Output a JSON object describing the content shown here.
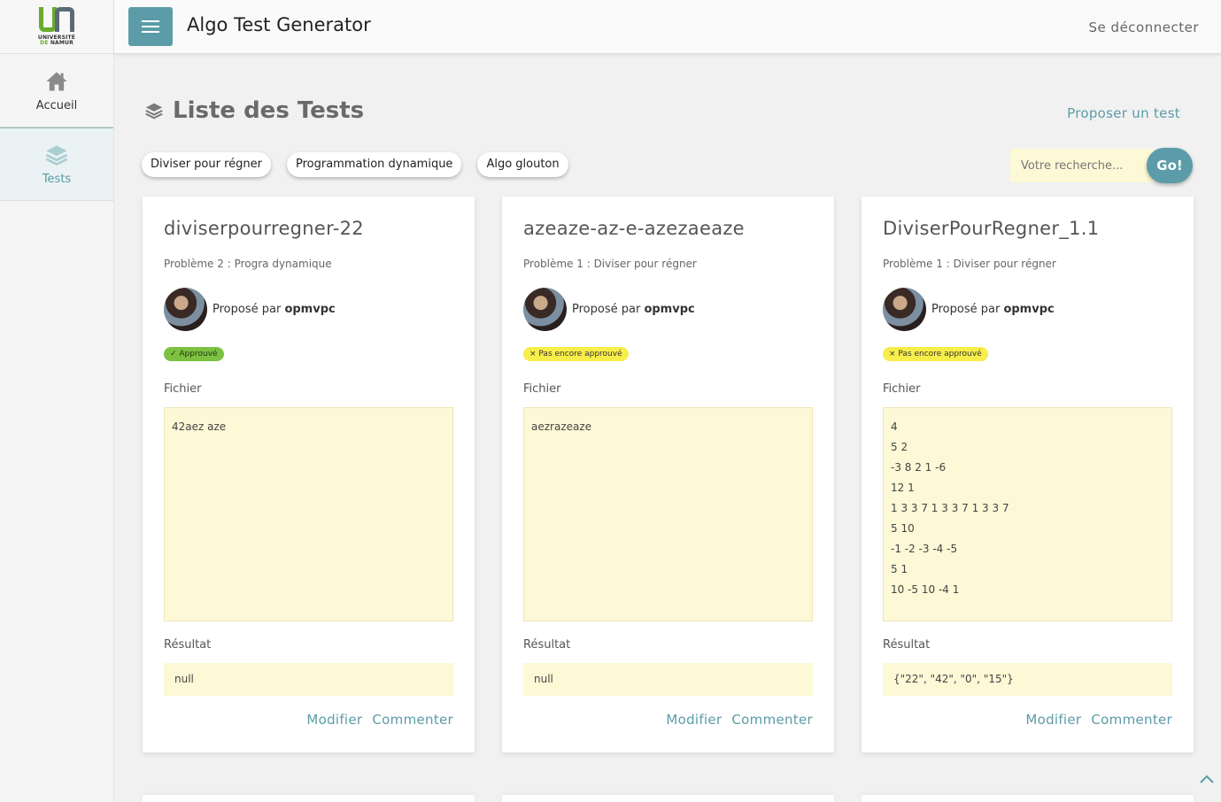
{
  "sidebar": {
    "logo_line1": "UNIVERSITÉ",
    "logo_de": "DE",
    "logo_line2": "NAMUR",
    "items": [
      {
        "label": "Accueil",
        "icon": "home-icon"
      },
      {
        "label": "Tests",
        "icon": "layers-icon"
      }
    ]
  },
  "header": {
    "title": "Algo Test Generator",
    "logout": "Se déconnecter"
  },
  "page": {
    "title": "Liste des Tests",
    "propose": "Proposer un test"
  },
  "filters": [
    "Diviser pour régner",
    "Programmation dynamique",
    "Algo glouton"
  ],
  "search": {
    "placeholder": "Votre recherche...",
    "button": "Go!"
  },
  "labels": {
    "proposed_by": "Proposé par",
    "file": "Fichier",
    "result": "Résultat",
    "edit": "Modifier",
    "comment": "Commenter"
  },
  "cards": [
    {
      "title": "diviserpourregner-22",
      "problem": "Problème 2 : Progra dynamique",
      "author": "opmvpc",
      "status": "✓ Approuvé",
      "status_kind": "approved",
      "file": "42aez aze",
      "result": "null"
    },
    {
      "title": "azeaze-az-e-azezaeaze",
      "problem": "Problème 1 : Diviser pour régner",
      "author": "opmvpc",
      "status": "× Pas encore approuvé",
      "status_kind": "pending",
      "file": "aezrazeaze",
      "result": "null"
    },
    {
      "title": "DiviserPourRegner_1.1",
      "problem": "Problème 1 : Diviser pour régner",
      "author": "opmvpc",
      "status": "× Pas encore approuvé",
      "status_kind": "pending",
      "file": "4\n5 2\n-3 8 2 1 -6\n12 1\n1 3 3 7 1 3 3 7 1 3 3 7\n5 10\n-1 -2 -3 -4 -5\n5 1\n10 -5 10 -4 1",
      "result": "{\"22\", \"42\", \"0\", \"15\"}"
    }
  ],
  "colors": {
    "accent": "#5b9ca8",
    "approved": "#7cc142",
    "pending": "#f7ee4a",
    "field_bg": "#fdf8d6"
  }
}
